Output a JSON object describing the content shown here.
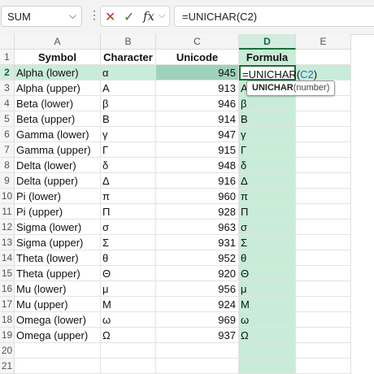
{
  "formula_bar": {
    "name_box": "SUM",
    "name_box_arrow": "⌵",
    "more_dots": "⋮",
    "cancel_icon": "✕",
    "enter_icon": "✓",
    "fx_label": "fx",
    "fx_arrow": "⌵",
    "formula": "=UNICHAR(C2)"
  },
  "columns": [
    "A",
    "B",
    "C",
    "D",
    "E"
  ],
  "rows": [
    "1",
    "2",
    "3",
    "4",
    "5",
    "6",
    "7",
    "8",
    "9",
    "10",
    "11",
    "12",
    "13",
    "14",
    "15",
    "16",
    "17",
    "18",
    "19",
    "20",
    "21"
  ],
  "headers": {
    "symbol": "Symbol",
    "character": "Character",
    "unicode": "Unicode",
    "formula": "Formula"
  },
  "active_cell": {
    "prefix": "=UNICHAR(",
    "ref": "C2",
    "suffix": ")"
  },
  "tooltip": {
    "function": "UNICHAR",
    "args": "(number)"
  },
  "table": [
    {
      "symbol": "Alpha (lower)",
      "character": "α",
      "unicode": "945",
      "result": ""
    },
    {
      "symbol": "Alpha (upper)",
      "character": "Α",
      "unicode": "913",
      "result": "Α"
    },
    {
      "symbol": "Beta (lower)",
      "character": "β",
      "unicode": "946",
      "result": "β"
    },
    {
      "symbol": "Beta (upper)",
      "character": "Β",
      "unicode": "914",
      "result": "Β"
    },
    {
      "symbol": "Gamma (lower)",
      "character": "γ",
      "unicode": "947",
      "result": "γ"
    },
    {
      "symbol": "Gamma (upper)",
      "character": "Γ",
      "unicode": "915",
      "result": "Γ"
    },
    {
      "symbol": "Delta (lower)",
      "character": "δ",
      "unicode": "948",
      "result": "δ"
    },
    {
      "symbol": "Delta (upper)",
      "character": "Δ",
      "unicode": "916",
      "result": "Δ"
    },
    {
      "symbol": "Pi (lower)",
      "character": "π",
      "unicode": "960",
      "result": "π"
    },
    {
      "symbol": "Pi (upper)",
      "character": "Π",
      "unicode": "928",
      "result": "Π"
    },
    {
      "symbol": "Sigma (lower)",
      "character": "σ",
      "unicode": "963",
      "result": "σ"
    },
    {
      "symbol": "Sigma (upper)",
      "character": "Σ",
      "unicode": "931",
      "result": "Σ"
    },
    {
      "symbol": "Theta (lower)",
      "character": "θ",
      "unicode": "952",
      "result": "θ"
    },
    {
      "symbol": "Theta (upper)",
      "character": "Θ",
      "unicode": "920",
      "result": "Θ"
    },
    {
      "symbol": "Mu (lower)",
      "character": "μ",
      "unicode": "956",
      "result": "μ"
    },
    {
      "symbol": "Mu (upper)",
      "character": "Μ",
      "unicode": "924",
      "result": "Μ"
    },
    {
      "symbol": "Omega (lower)",
      "character": "ω",
      "unicode": "969",
      "result": "ω"
    },
    {
      "symbol": "Omega (upper)",
      "character": "Ω",
      "unicode": "937",
      "result": "Ω"
    }
  ],
  "colors": {
    "accent": "#137333",
    "selection_fill": "#c8ecd7",
    "reference_blue": "#1a6fd6"
  }
}
